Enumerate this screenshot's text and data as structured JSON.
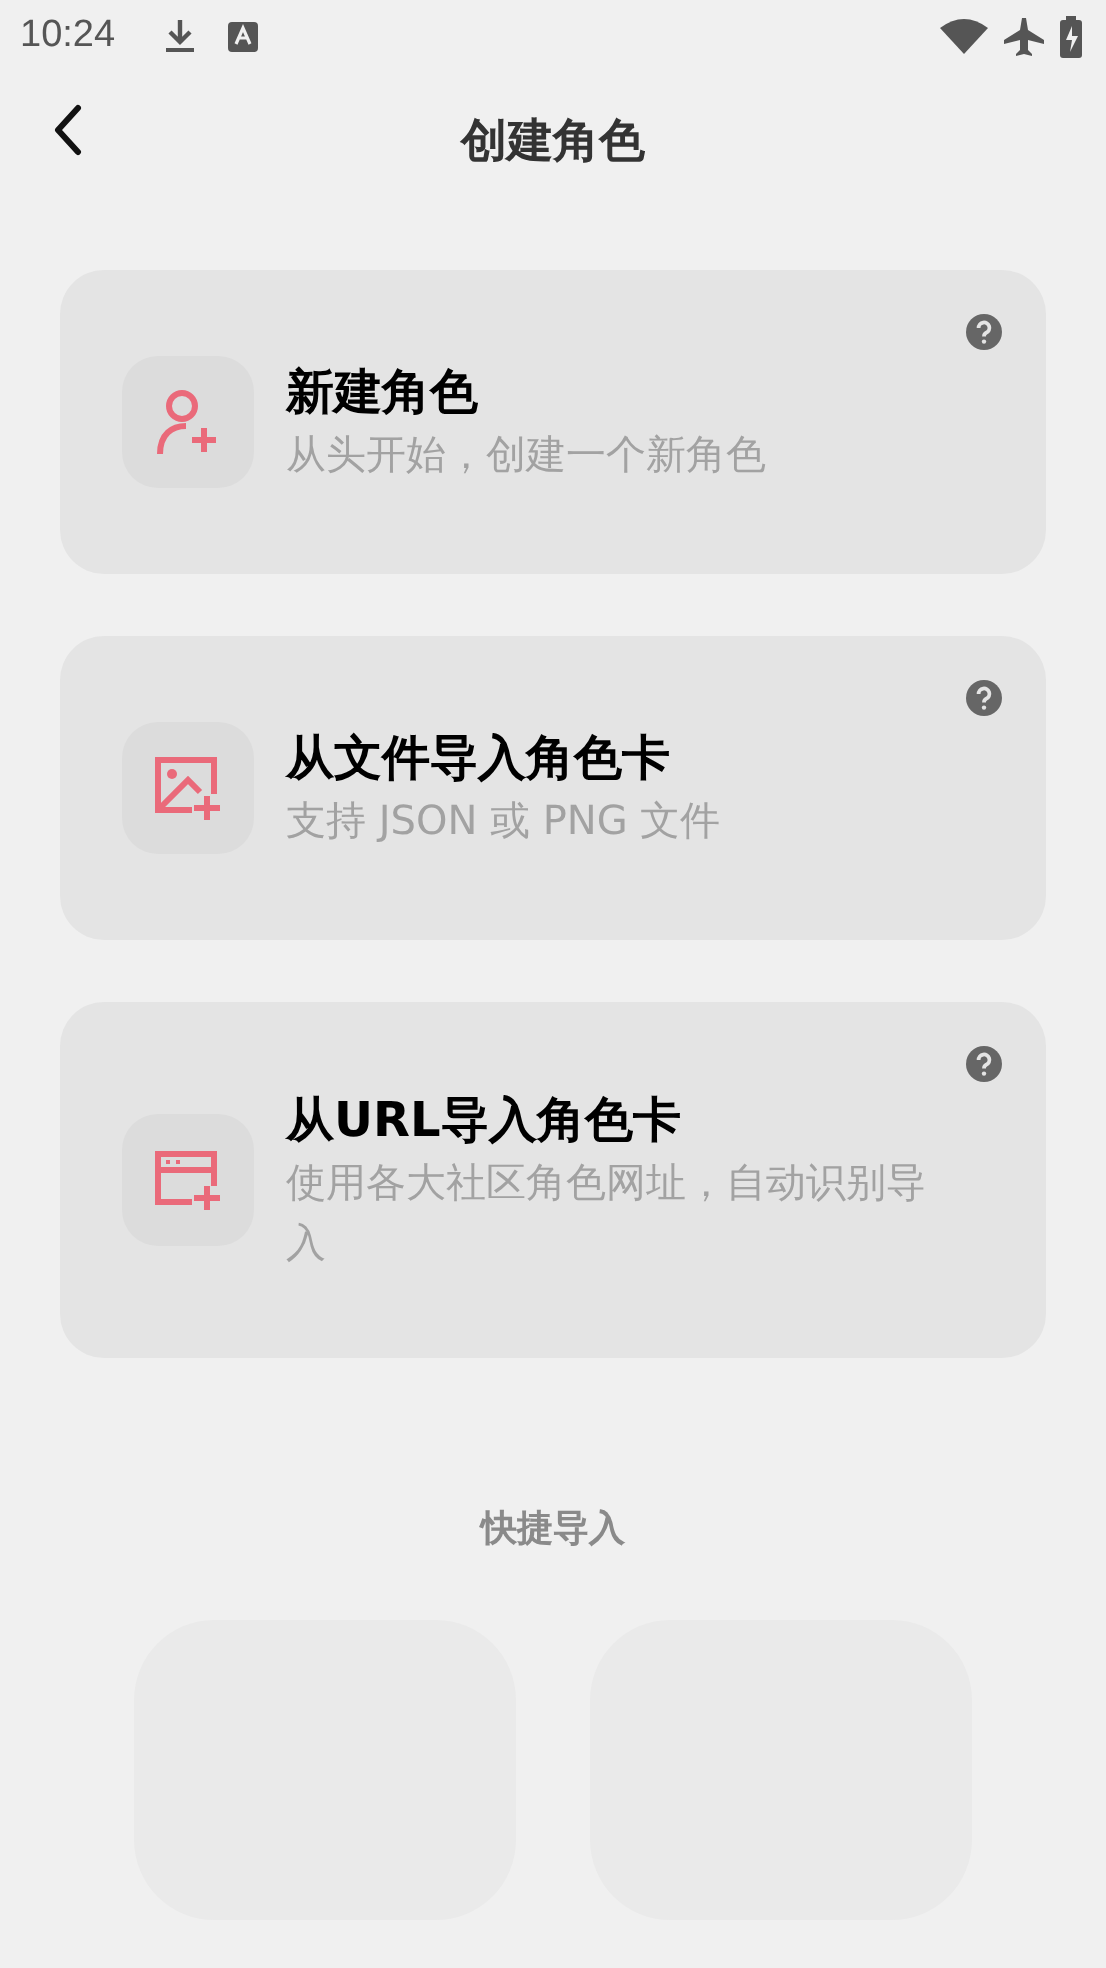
{
  "status_bar": {
    "time": "10:24"
  },
  "header": {
    "title": "创建角色"
  },
  "options": [
    {
      "kind": "person-add",
      "title": "新建角色",
      "subtitle": "从头开始，创建一个新角色"
    },
    {
      "kind": "image-add",
      "title": "从文件导入角色卡",
      "subtitle": "支持 JSON 或 PNG 文件"
    },
    {
      "kind": "window-add",
      "title": "从URL导入角色卡",
      "subtitle": "使用各大社区角色网址，自动识别导入"
    }
  ],
  "quick_import": {
    "title": "快捷导入",
    "tiles": [
      {
        "kind": "tile"
      },
      {
        "kind": "tile"
      }
    ]
  }
}
